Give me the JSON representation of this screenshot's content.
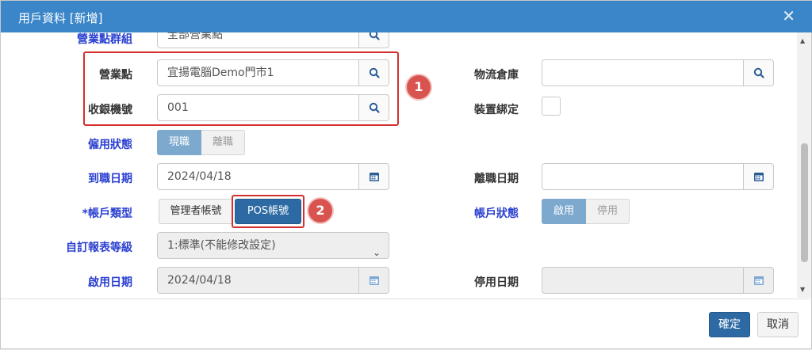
{
  "dialog": {
    "title": "用戶資料 [新增]",
    "close": "✕"
  },
  "fields": {
    "site_group_label": "營業點群組",
    "site_group_value": "全部營業點",
    "site_label": "營業點",
    "site_value": "宜揚電腦Demo門市1",
    "pos_label": "收銀機號",
    "pos_value": "001",
    "warehouse_label": "物流倉庫",
    "device_bind_label": "裝置綁定",
    "employment_label": "僱用狀態",
    "employment_options": [
      "現職",
      "離職"
    ],
    "hire_date_label": "到職日期",
    "hire_date_value": "2024/04/18",
    "leave_date_label": "離職日期",
    "account_type_label": "*帳戶類型",
    "account_type_options": [
      "管理者帳號",
      "POS帳號"
    ],
    "account_status_label": "帳戶狀態",
    "account_status_options": [
      "啟用",
      "停用"
    ],
    "report_level_label": "自訂報表等級",
    "report_level_value": "1:標準(不能修改設定)",
    "enable_date_label": "啟用日期",
    "enable_date_value": "2024/04/18",
    "disable_date_label": "停用日期"
  },
  "annotations": {
    "badge1": "1",
    "badge2": "2"
  },
  "footer": {
    "confirm": "確定",
    "cancel": "取消"
  },
  "colors": {
    "titlebar": "#3a86c8",
    "primary": "#2d6aa4",
    "active_toggle": "#7ea9cf",
    "highlight": "#d32f2f",
    "label_blue": "#2a3fd0"
  },
  "icons": {
    "search": "search-icon",
    "calendar": "calendar-icon",
    "dropdown": "chevron-down-icon"
  }
}
